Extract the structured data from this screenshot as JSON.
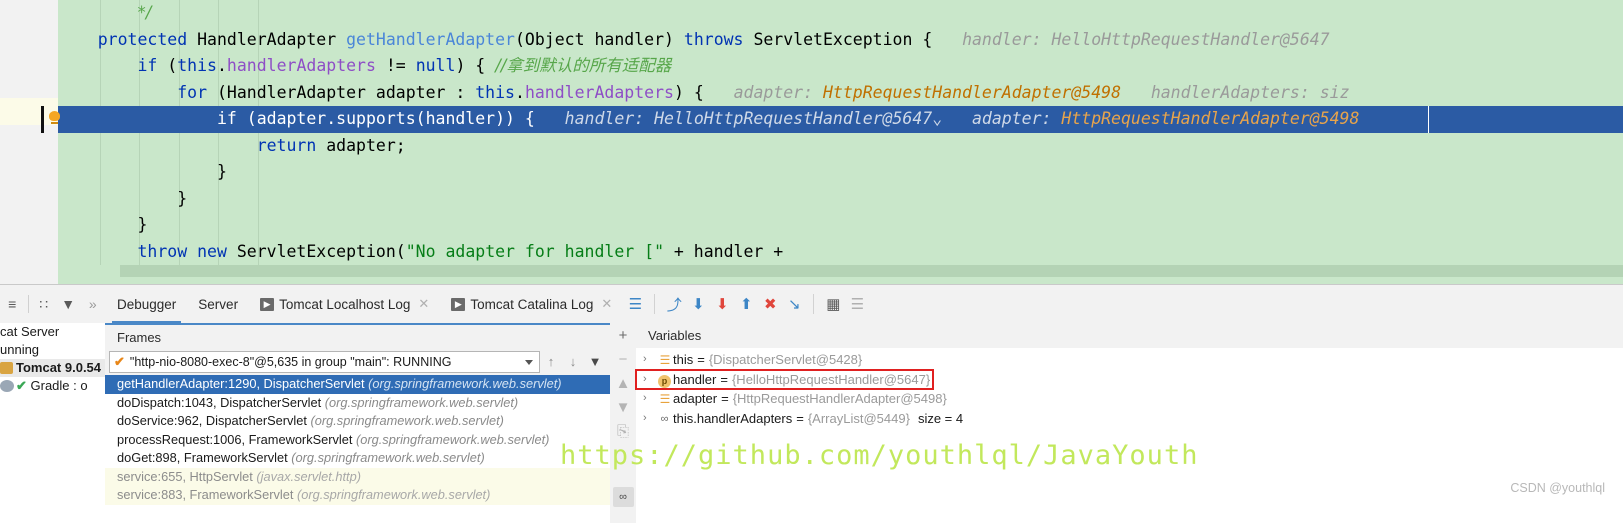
{
  "editor": {
    "language": "java",
    "background_color": "#c9e7ca",
    "current_line_color": "#2b5ba4",
    "lines": [
      {
        "id": "line-comment-end",
        "indent": 2,
        "tokens": [
          {
            "t": "*/",
            "c": "cmt"
          }
        ],
        "hints": []
      },
      {
        "id": "line-method-signature",
        "indent": 1,
        "tokens": [
          {
            "t": "protected ",
            "c": "kw"
          },
          {
            "t": "HandlerAdapter ",
            "c": "plain"
          },
          {
            "t": "getHandlerAdapter",
            "c": "meth"
          },
          {
            "t": "(Object handler) ",
            "c": "plain"
          },
          {
            "t": "throws ",
            "c": "kw"
          },
          {
            "t": "ServletException {",
            "c": "plain"
          }
        ],
        "hints": [
          {
            "label": "handler:",
            "value": "HelloHttpRequestHandler@5647",
            "value_style": "hint"
          }
        ]
      },
      {
        "id": "line-if-null",
        "indent": 2,
        "tokens": [
          {
            "t": "if ",
            "c": "kw"
          },
          {
            "t": "(",
            "c": "plain"
          },
          {
            "t": "this",
            "c": "kw"
          },
          {
            "t": ".",
            "c": "plain"
          },
          {
            "t": "handlerAdapters",
            "c": "fld"
          },
          {
            "t": " != ",
            "c": "plain"
          },
          {
            "t": "null",
            "c": "kw"
          },
          {
            "t": ") { ",
            "c": "plain"
          },
          {
            "t": "//拿到默认的所有适配器",
            "c": "cmt"
          }
        ],
        "hints": []
      },
      {
        "id": "line-for-loop",
        "indent": 3,
        "tokens": [
          {
            "t": "for ",
            "c": "kw"
          },
          {
            "t": "(HandlerAdapter adapter : ",
            "c": "plain"
          },
          {
            "t": "this",
            "c": "kw"
          },
          {
            "t": ".",
            "c": "plain"
          },
          {
            "t": "handlerAdapters",
            "c": "fld"
          },
          {
            "t": ") {",
            "c": "plain"
          }
        ],
        "hints": [
          {
            "label": "adapter:",
            "value": "HttpRequestHandlerAdapter@5498",
            "value_style": "hintv"
          },
          {
            "label": "handlerAdapters:",
            "value": "siz",
            "value_style": "hint"
          }
        ]
      },
      {
        "id": "line-if-supports",
        "indent": 4,
        "current": true,
        "has_breakpoint_bulb": true,
        "tokens": [
          {
            "t": "if ",
            "c": "kw"
          },
          {
            "t": "(adapter.supports(handler)) {",
            "c": "plain"
          }
        ],
        "hints": [
          {
            "label": "handler:",
            "value": "HelloHttpRequestHandler@5647⌄",
            "value_style": "hint"
          },
          {
            "label": "adapter:",
            "value": "HttpRequestHandlerAdapter@5498",
            "value_style": "hintv"
          }
        ]
      },
      {
        "id": "line-return",
        "indent": 5,
        "tokens": [
          {
            "t": "return ",
            "c": "kw"
          },
          {
            "t": "adapter;",
            "c": "plain"
          }
        ],
        "hints": []
      },
      {
        "id": "line-close-brace-1",
        "indent": 4,
        "tokens": [
          {
            "t": "}",
            "c": "plain"
          }
        ],
        "hints": []
      },
      {
        "id": "line-close-brace-2",
        "indent": 3,
        "tokens": [
          {
            "t": "}",
            "c": "plain"
          }
        ],
        "hints": []
      },
      {
        "id": "line-close-brace-3",
        "indent": 2,
        "tokens": [
          {
            "t": "}",
            "c": "plain"
          }
        ],
        "hints": []
      },
      {
        "id": "line-throw",
        "indent": 2,
        "tokens": [
          {
            "t": "throw new ",
            "c": "kw"
          },
          {
            "t": "ServletException(",
            "c": "plain"
          },
          {
            "t": "\"No adapter for handler [\"",
            "c": "str"
          },
          {
            "t": " + handler +",
            "c": "plain"
          }
        ],
        "hints": []
      }
    ]
  },
  "debug_toolbar": {
    "left_icons": [
      {
        "name": "collapse-all-icon",
        "glyph": "≡"
      },
      {
        "name": "layout-icon",
        "glyph": "∷"
      },
      {
        "name": "filter-icon",
        "glyph": "▼"
      },
      {
        "name": "more-icon",
        "glyph": "»"
      }
    ],
    "tabs": [
      {
        "name": "tab-debugger",
        "label": "Debugger",
        "selected": true,
        "has_run_icon": false,
        "closable": false
      },
      {
        "name": "tab-server",
        "label": "Server",
        "selected": false,
        "has_run_icon": false,
        "closable": false
      },
      {
        "name": "tab-tomcat-localhost-log",
        "label": "Tomcat Localhost Log",
        "selected": false,
        "has_run_icon": true,
        "closable": true
      },
      {
        "name": "tab-tomcat-catalina-log",
        "label": "Tomcat Catalina Log",
        "selected": false,
        "has_run_icon": true,
        "closable": true
      }
    ],
    "right_icons": [
      {
        "name": "console-icon",
        "glyph": "☰",
        "color": "#3d86c6"
      },
      {
        "name": "step-over-icon",
        "glyph": "⤴",
        "color": "#3d86c6"
      },
      {
        "name": "step-into-icon",
        "glyph": "⬇",
        "color": "#3d86c6"
      },
      {
        "name": "force-step-into-icon",
        "glyph": "⬇",
        "color": "#e0463c"
      },
      {
        "name": "step-out-icon",
        "glyph": "⬆",
        "color": "#3d86c6"
      },
      {
        "name": "drop-frame-icon",
        "glyph": "✖",
        "color": "#e0463c"
      },
      {
        "name": "run-to-cursor-icon",
        "glyph": "↘",
        "color": "#3d86c6"
      },
      {
        "name": "evaluate-expression-icon",
        "glyph": "▦",
        "color": "#5a5a5a"
      },
      {
        "name": "settings-icon",
        "glyph": "☰",
        "color": "#b0b0b0"
      }
    ]
  },
  "services_tree": {
    "rows": [
      {
        "name": "tree-row-tomcat-server",
        "label": "cat Server",
        "bold": false,
        "icon": "none",
        "clipped": true
      },
      {
        "name": "tree-row-running",
        "label": "unning",
        "bold": false,
        "icon": "none",
        "clipped": true
      },
      {
        "name": "tree-row-tomcat-version",
        "label": "Tomcat 9.0.54 [",
        "bold": true,
        "icon": "tomcat",
        "clipped": true
      },
      {
        "name": "tree-row-gradle",
        "label": "Gradle : o",
        "bold": false,
        "icon": "gradle-check",
        "clipped": true
      }
    ]
  },
  "frames": {
    "title": "Frames",
    "thread": {
      "name": "thread-selector",
      "label": "\"http-nio-8080-exec-8\"@5,635 in group \"main\": RUNNING",
      "status_icon": "check-orange"
    },
    "nav": [
      {
        "name": "frames-up-button",
        "glyph": "↑"
      },
      {
        "name": "frames-down-button",
        "glyph": "↓"
      },
      {
        "name": "frames-filter-button",
        "glyph": "▼"
      }
    ],
    "list": [
      {
        "name": "frame-row-getHandlerAdapter",
        "method": "getHandlerAdapter:1290, DispatcherServlet",
        "pkg": "(org.springframework.web.servlet)",
        "selected": true,
        "muted": false
      },
      {
        "name": "frame-row-doDispatch",
        "method": "doDispatch:1043, DispatcherServlet",
        "pkg": "(org.springframework.web.servlet)",
        "selected": false,
        "muted": false
      },
      {
        "name": "frame-row-doService",
        "method": "doService:962, DispatcherServlet",
        "pkg": "(org.springframework.web.servlet)",
        "selected": false,
        "muted": false
      },
      {
        "name": "frame-row-processRequest",
        "method": "processRequest:1006, FrameworkServlet",
        "pkg": "(org.springframework.web.servlet)",
        "selected": false,
        "muted": false
      },
      {
        "name": "frame-row-doGet",
        "method": "doGet:898, FrameworkServlet",
        "pkg": "(org.springframework.web.servlet)",
        "selected": false,
        "muted": false
      },
      {
        "name": "frame-row-service-httpservlet",
        "method": "service:655, HttpServlet",
        "pkg": "(javax.servlet.http)",
        "selected": false,
        "muted": true
      },
      {
        "name": "frame-row-service-frameworkservlet",
        "method": "service:883, FrameworkServlet",
        "pkg": "(org.springframework.web.servlet)",
        "selected": false,
        "muted": true
      }
    ]
  },
  "variables_toolbar": {
    "buttons": [
      {
        "name": "add-watch-button",
        "glyph": "+",
        "dim": false
      },
      {
        "name": "remove-watch-button",
        "glyph": "−",
        "dim": true
      },
      {
        "name": "move-up-button",
        "glyph": "▲",
        "dim": true
      },
      {
        "name": "move-down-button",
        "glyph": "▼",
        "dim": true
      },
      {
        "name": "copy-button",
        "glyph": "⎘",
        "dim": true
      },
      {
        "name": "watches-button",
        "glyph": "∞",
        "dim": false
      }
    ]
  },
  "variables": {
    "title": "Variables",
    "rows": [
      {
        "name": "var-row-this",
        "icon": "list-icon",
        "varname": "this",
        "value": "{DispatcherServlet@5428}",
        "size": "",
        "flagged": false
      },
      {
        "name": "var-row-handler",
        "icon": "parameter-icon",
        "varname": "handler",
        "value": "{HelloHttpRequestHandler@5647}",
        "size": "",
        "flagged": true
      },
      {
        "name": "var-row-adapter",
        "icon": "list-icon",
        "varname": "adapter",
        "value": "{HttpRequestHandlerAdapter@5498}",
        "size": "",
        "flagged": false
      },
      {
        "name": "var-row-handlerAdapters",
        "icon": "field-icon",
        "varname": "this.handlerAdapters",
        "value": "{ArrayList@5449}",
        "size": "size = 4",
        "flagged": false
      }
    ]
  },
  "overlays": {
    "watermark": "https://github.com/youthlql/JavaYouth",
    "watermark_color": "#c2e85c",
    "credit": "CSDN @youthlql"
  }
}
